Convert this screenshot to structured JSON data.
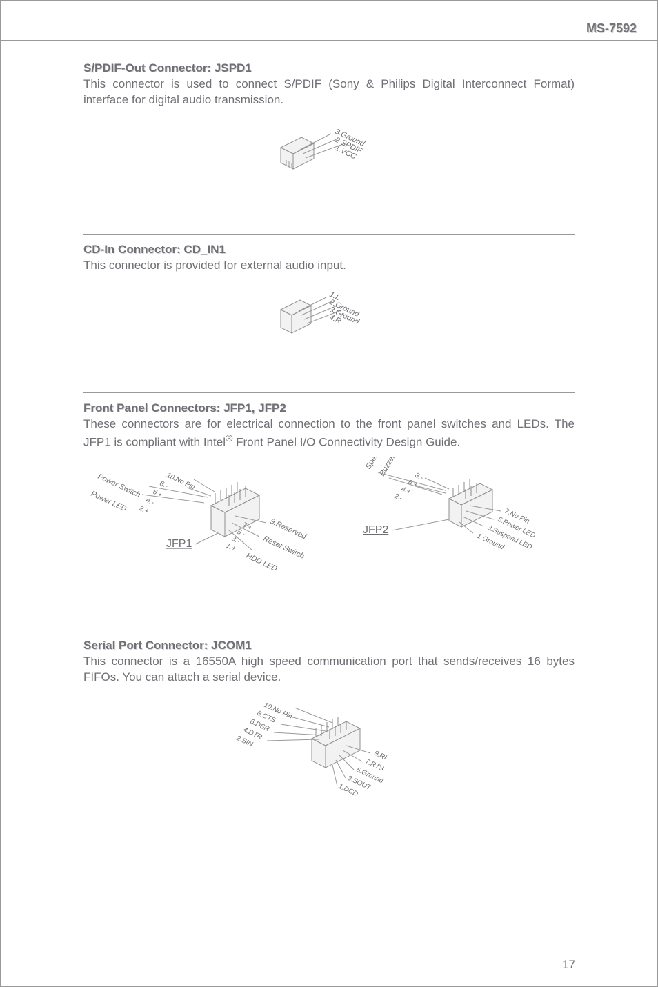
{
  "model": "MS-7592",
  "page_num": "17",
  "s1": {
    "title": "S/PDIF-Out Connector: JSPD1",
    "body": "This connector is used to connect S/PDIF (Sony & Philips Digital Interconnect Format) interface for digital audio transmission.",
    "pins": [
      "1.VCC",
      "2.SPDIF",
      "3.Ground"
    ]
  },
  "s2": {
    "title": "CD-In Connector: CD_IN1",
    "body": "This connector is provided for external audio input.",
    "pins": [
      "1.L",
      "2.Ground",
      "3.Ground",
      "4.R"
    ]
  },
  "s3": {
    "title": "Front Panel Connectors: JFP1, JFP2",
    "body_a": "These connectors are for electrical connection to the front panel switches and LEDs. The JFP1 is compliant with Intel",
    "body_b": " Front Panel I/O Connectivity Design Guide.",
    "reg": "®",
    "jfp1": {
      "label": "JFP1",
      "left": [
        "Power Switch",
        "Power LED"
      ],
      "left_pins": [
        "10.No Pin",
        "8.-",
        "6.+",
        "4.-",
        "2.+"
      ],
      "right": [
        "9.Reserved",
        "Reset Switch",
        "HDD LED"
      ],
      "right_pins": [
        "9.Reserved",
        "7.+",
        "5.-",
        "3.-",
        "1.+"
      ]
    },
    "jfp2": {
      "label": "JFP2",
      "left": [
        "Speaker",
        "Buzzer"
      ],
      "left_pins": [
        "8.-",
        "6.+",
        "4.+",
        "2.-"
      ],
      "right_pins": [
        "7.No Pin",
        "5.Power LED",
        "3.Suspend LED",
        "1.Ground"
      ]
    }
  },
  "s4": {
    "title": "Serial Port Connector: JCOM1",
    "body": "This connector is a 16550A high speed communication port that sends/receives 16 bytes FIFOs. You can attach a serial device.",
    "left_pins": [
      "10.No Pin",
      "8.CTS",
      "6.DSR",
      "4.DTR",
      "2.SIN"
    ],
    "right_pins": [
      "9.RI",
      "7.RTS",
      "5.Ground",
      "3.SOUT",
      "1.DCD"
    ]
  }
}
